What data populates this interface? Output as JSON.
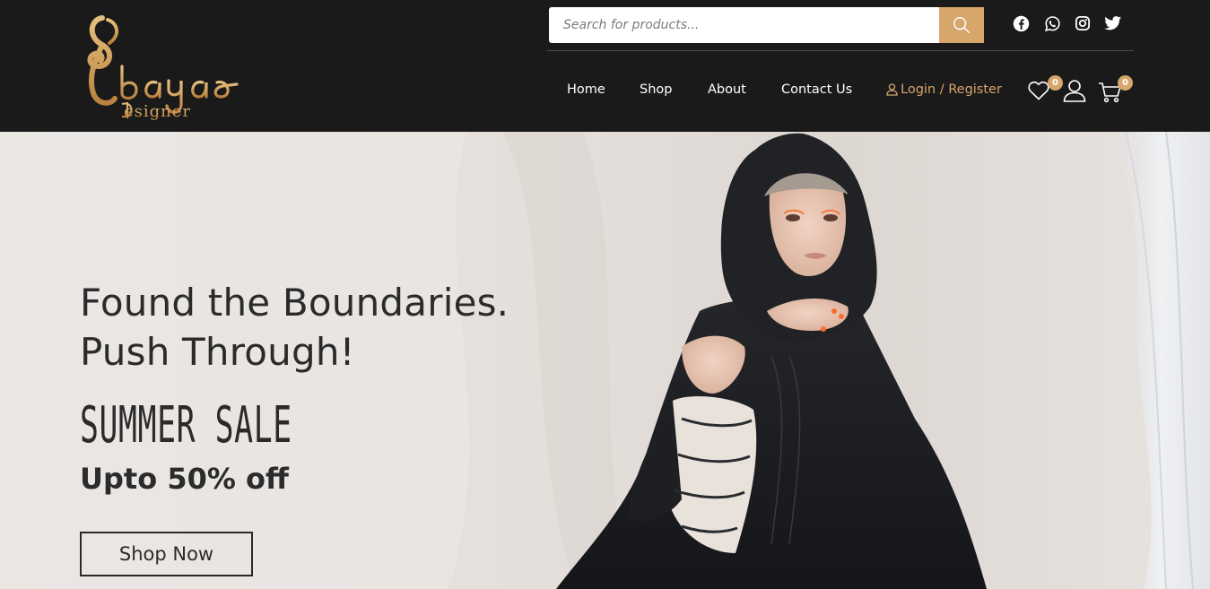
{
  "brand": {
    "logo_alt": "Abaya Designer",
    "colors": {
      "accent": "#d6a66a",
      "header_bg": "#1a1a1a",
      "text_dark": "#2b2b2b"
    }
  },
  "search": {
    "placeholder": "Search for products...",
    "icon": "search-icon"
  },
  "social": [
    {
      "name": "facebook-icon"
    },
    {
      "name": "whatsapp-icon"
    },
    {
      "name": "instagram-icon"
    },
    {
      "name": "twitter-icon"
    }
  ],
  "nav": {
    "home": "Home",
    "shop": "Shop",
    "about": "About",
    "contact": "Contact Us",
    "login": "Login / Register"
  },
  "header_icons": {
    "wishlist_count": "0",
    "cart_count": "0"
  },
  "hero": {
    "headline_line1": "Found the Boundaries.",
    "headline_line2": "Push Through!",
    "sale_title": "SUMMER SALE",
    "sale_subtitle": "Upto 50% off",
    "cta": "Shop Now"
  }
}
